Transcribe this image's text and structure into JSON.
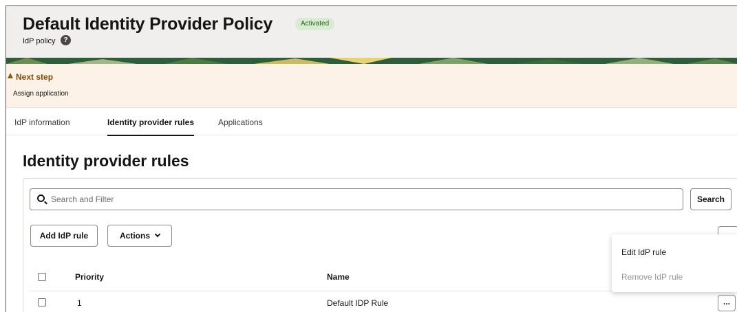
{
  "header": {
    "title": "Default Identity Provider Policy",
    "status_badge": "Activated",
    "subtitle": "IdP policy",
    "help_icon": "question-circle-icon"
  },
  "next_step": {
    "title": "Next step",
    "text": "Assign application",
    "icon": "warning-triangle-icon"
  },
  "tabs": [
    {
      "label": "IdP information",
      "active": false
    },
    {
      "label": "Identity provider rules",
      "active": true
    },
    {
      "label": "Applications",
      "active": false
    }
  ],
  "section": {
    "title": "Identity provider rules"
  },
  "search": {
    "placeholder": "Search and Filter",
    "value": "",
    "button_label": "Search"
  },
  "toolbar": {
    "add_label": "Add IdP rule",
    "actions_label": "Actions"
  },
  "context_menu": {
    "edit_label": "Edit IdP rule",
    "remove_label": "Remove IdP rule"
  },
  "table": {
    "columns": [
      "Priority",
      "Name"
    ],
    "rows": [
      {
        "priority": "1",
        "name": "Default IDP Rule",
        "menu_label": "..."
      }
    ]
  },
  "colors": {
    "badge_bg": "#d7ecd1",
    "next_step_bg": "#fcf2e7",
    "next_step_title": "#7a4a0a",
    "header_bg": "#f1efed"
  }
}
